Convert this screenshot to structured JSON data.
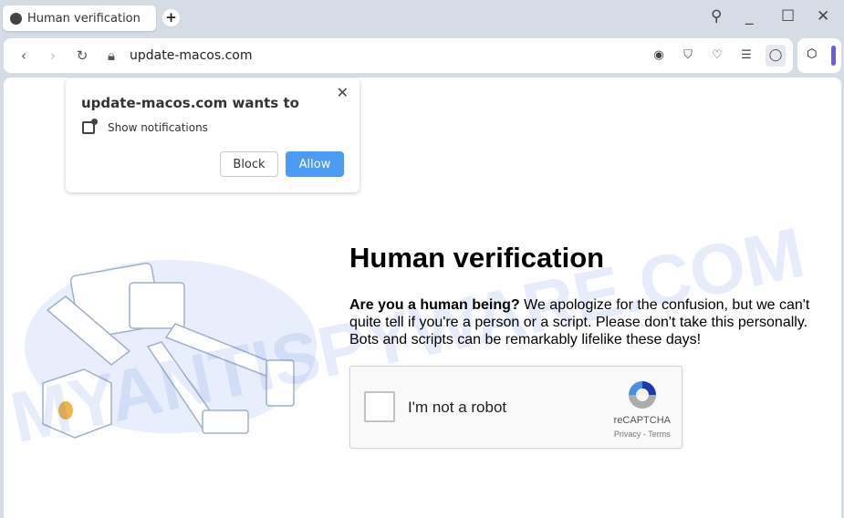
{
  "browser": {
    "tab_title": "Human verification",
    "url": "update-macos.com",
    "accent": "#6b5ce7"
  },
  "popup": {
    "title": "update-macos.com wants to",
    "permission": "Show notifications",
    "block_label": "Block",
    "allow_label": "Allow",
    "allow_color": "#4b9bf5"
  },
  "page": {
    "heading": "Human verification",
    "question": "Are you a human being?",
    "text": " We apologize for the confusion, but we can't quite tell if you're a person or a script. Please don't take this personally. Bots and scripts can be remarkably lifelike these days!"
  },
  "captcha": {
    "label": "I'm not a robot",
    "brand": "reCAPTCHA",
    "links": "Privacy - Terms",
    "checked": false
  },
  "watermark": "MYANTISPYWARE.COM"
}
